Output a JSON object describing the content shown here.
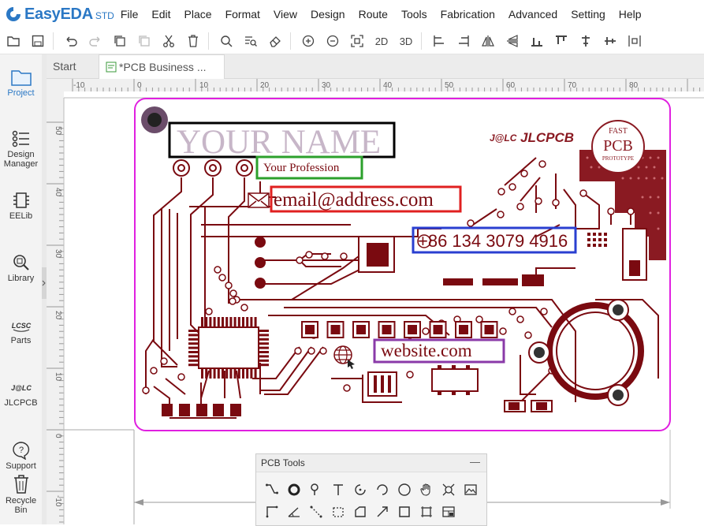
{
  "app": {
    "logo_text": "EasyEDA",
    "logo_edition": "STD"
  },
  "menu": [
    "File",
    "Edit",
    "Place",
    "Format",
    "View",
    "Design",
    "Route",
    "Tools",
    "Fabrication",
    "Advanced",
    "Setting",
    "Help"
  ],
  "toolbar": {
    "view_2d": "2D",
    "view_3d": "3D"
  },
  "leftbar": [
    {
      "label": "Project"
    },
    {
      "label": "Design Manager"
    },
    {
      "label": "EELib"
    },
    {
      "label": "Library"
    },
    {
      "label": "Parts"
    },
    {
      "label": "JLCPCB"
    },
    {
      "label": "Support"
    },
    {
      "label": "Recycle Bin"
    }
  ],
  "tabs": [
    {
      "label": "Start"
    },
    {
      "label": "*PCB Business ..."
    }
  ],
  "ruler": {
    "top_ticks": [
      "-10",
      "0",
      "10",
      "20",
      "30",
      "40",
      "50",
      "60",
      "70",
      "80"
    ],
    "left_ticks": [
      "50",
      "40",
      "30",
      "20",
      "10",
      "0",
      "-10"
    ]
  },
  "card": {
    "name": "YOUR NAME",
    "profession": "Your Profession",
    "email": "email@address.com",
    "phone": "+86 134 3079 4916",
    "website": "website.com",
    "brand": "JLCPCB",
    "brand_badge": "J@LC",
    "stamp_top": "FAST",
    "stamp_mid": "PCB",
    "stamp_bottom": "PROTOTYPE"
  },
  "colors": {
    "accent": "#2b78c5",
    "trace": "#7a0a10",
    "outline": "#e020e0",
    "name_box": "#000000",
    "profession_box": "#2ca02c",
    "email_box": "#e02020",
    "phone_box": "#2a3fd0",
    "website_box": "#8a3aa8"
  },
  "pcb_tools": {
    "title": "PCB Tools",
    "minimize": "—"
  }
}
